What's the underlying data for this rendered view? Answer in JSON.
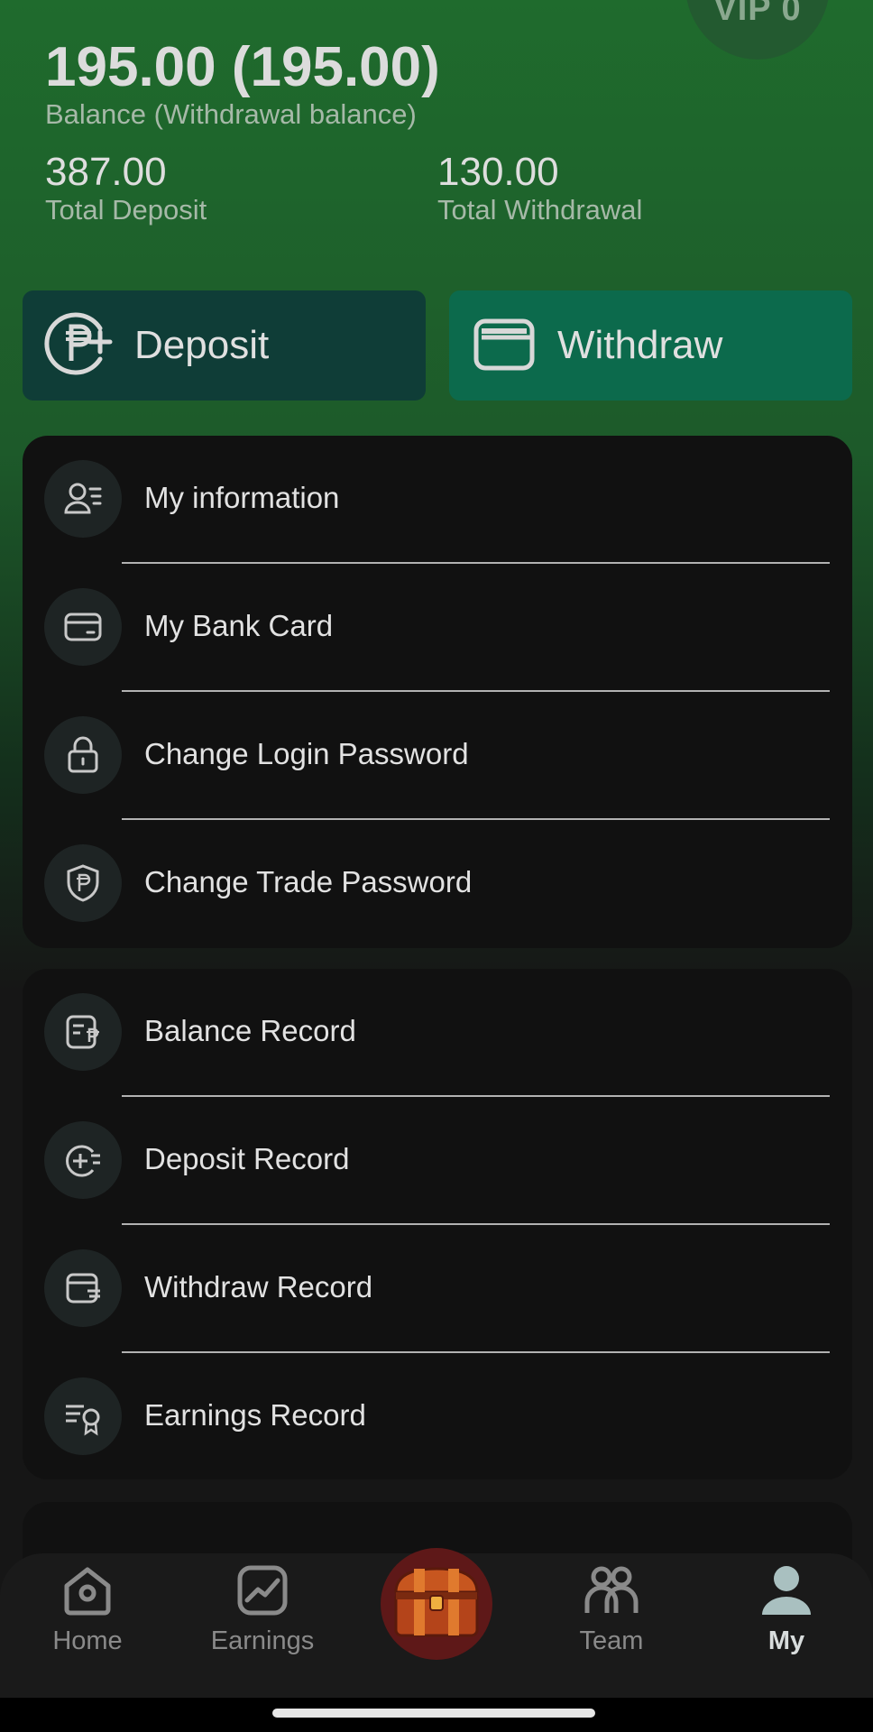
{
  "vip": {
    "label": "VIP 0"
  },
  "balance": {
    "amount": "195.00 (195.00)",
    "label": "Balance (Withdrawal balance)"
  },
  "stats": {
    "total_deposit": {
      "value": "387.00",
      "label": "Total Deposit"
    },
    "total_withdrawal": {
      "value": "130.00",
      "label": "Total Withdrawal"
    }
  },
  "actions": {
    "deposit_label": "Deposit",
    "withdraw_label": "Withdraw"
  },
  "account_menu": [
    {
      "label": "My information",
      "icon": "user-info-icon"
    },
    {
      "label": "My Bank Card",
      "icon": "bank-card-icon"
    },
    {
      "label": "Change Login Password",
      "icon": "lock-icon"
    },
    {
      "label": "Change Trade Password",
      "icon": "shield-peso-icon"
    }
  ],
  "records_menu": [
    {
      "label": "Balance Record",
      "icon": "balance-record-icon"
    },
    {
      "label": "Deposit Record",
      "icon": "deposit-record-icon"
    },
    {
      "label": "Withdraw Record",
      "icon": "withdraw-record-icon"
    },
    {
      "label": "Earnings Record",
      "icon": "earnings-record-icon"
    }
  ],
  "nav": {
    "home": "Home",
    "earnings": "Earnings",
    "team": "Team",
    "my": "My",
    "active": "My"
  },
  "colors": {
    "deposit_button": "#0f3d37",
    "withdraw_button": "#0c6a4c",
    "card_bg": "#111111",
    "header_green": "#1f6b2d"
  }
}
